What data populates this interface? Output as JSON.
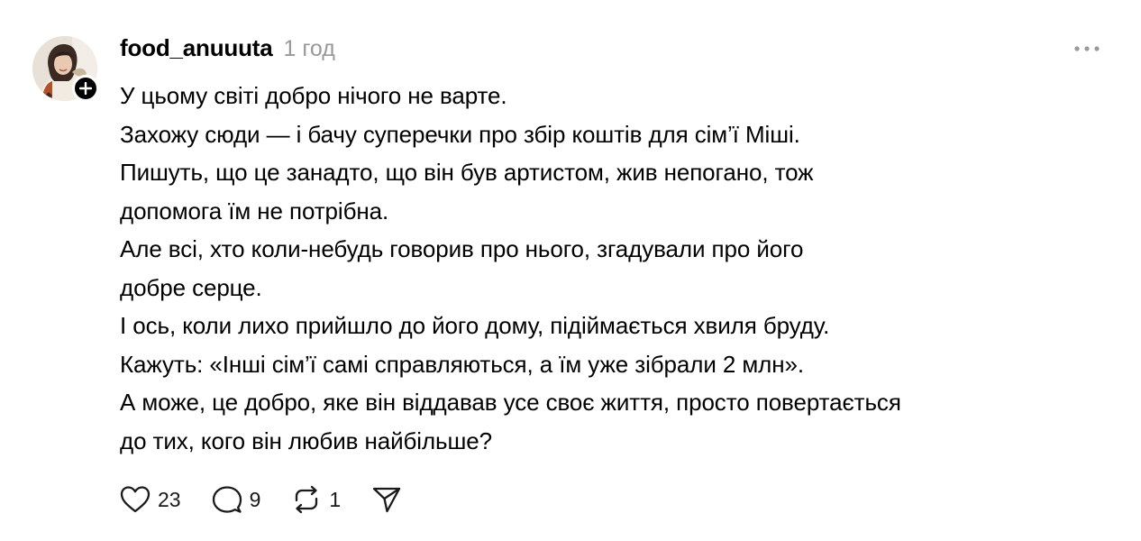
{
  "post": {
    "author": {
      "username": "food_anuuuta",
      "avatar_icon": "profile-photo",
      "follow_icon": "plus-icon"
    },
    "timestamp": "1 год",
    "more_icon": "more-horizontal-icon",
    "lines": [
      "У цьому світі добро нічого не варте.",
      "Захожу сюди — і бачу суперечки про збір коштів для сім’ї Міші.",
      "Пишуть, що це занадто, що він був артистом, жив непогано, тож",
      "допомога їм не потрібна.",
      "Але всі, хто коли-небудь говорив про нього, згадували про його",
      "добре серце.",
      "І ось, коли лихо прийшло до його дому, підіймається хвиля бруду.",
      "Кажуть: «Інші сім’ї самі справляються, а їм уже зібрали 2 млн».",
      "А може, це добро, яке він віддавав усе своє життя, просто повертається",
      "до тих, кого він любив найбільше?"
    ],
    "actions": {
      "likes": {
        "icon": "heart-icon",
        "count": "23"
      },
      "replies": {
        "icon": "comment-icon",
        "count": "9"
      },
      "reposts": {
        "icon": "repost-icon",
        "count": "1"
      },
      "share": {
        "icon": "send-icon"
      }
    }
  },
  "colors": {
    "text": "#000000",
    "muted": "#999999",
    "icon": "#1a1a1a",
    "background": "#ffffff"
  }
}
